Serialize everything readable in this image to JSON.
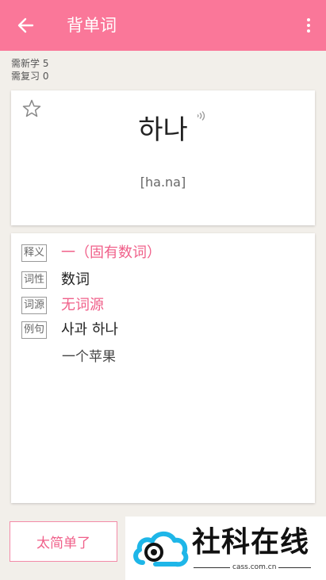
{
  "appbar": {
    "title": "背单词",
    "background": "#fa7799"
  },
  "counts": {
    "new": "需新学 5",
    "review": "需复习 0"
  },
  "word": {
    "hangul": "하나",
    "phonetic": "[ha.na]"
  },
  "details": {
    "meaning_tag": "释义",
    "meaning": "一（固有数词）",
    "pos_tag": "词性",
    "pos": "数词",
    "etym_tag": "词源",
    "etym": "无词源",
    "example_tag": "例句",
    "example": "사과 하나",
    "example_translation": "一个苹果"
  },
  "actions": {
    "too_easy": "太简单了"
  },
  "watermark": {
    "name": "社科在线",
    "domain": "cass.com.cn"
  },
  "colors": {
    "accent": "#fa7799",
    "accent_text": "#f0608a",
    "logo_blue": "#1eb6e8"
  },
  "icons": {
    "back": "back-arrow-icon",
    "more": "more-vertical-icon",
    "star": "star-outline-icon",
    "sound": "sound-wave-icon"
  }
}
